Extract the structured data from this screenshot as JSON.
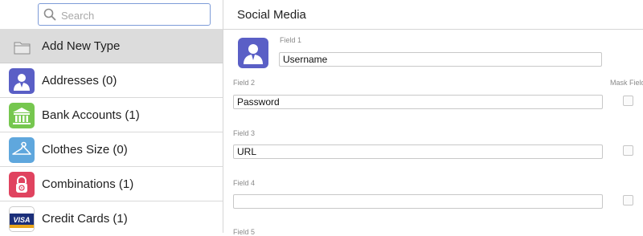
{
  "search": {
    "placeholder": "Search"
  },
  "sidebar": {
    "items": [
      {
        "label": "Add New Type",
        "icon": "folder-icon"
      },
      {
        "label": "Addresses (0)",
        "icon": "person-icon"
      },
      {
        "label": "Bank Accounts (1)",
        "icon": "bank-icon"
      },
      {
        "label": "Clothes Size (0)",
        "icon": "hanger-icon"
      },
      {
        "label": "Combinations (1)",
        "icon": "padlock-icon"
      },
      {
        "label": "Credit Cards (1)",
        "icon": "visa-card-icon",
        "badge": "VISA"
      }
    ]
  },
  "main": {
    "title": "Social Media",
    "type_icon": "person-icon",
    "mask_header": "Mask Field",
    "fields": [
      {
        "label": "Field 1",
        "value": "Username"
      },
      {
        "label": "Field 2",
        "value": "Password"
      },
      {
        "label": "Field 3",
        "value": "URL"
      },
      {
        "label": "Field 4",
        "value": ""
      },
      {
        "label": "Field 5",
        "value": ""
      }
    ]
  },
  "colors": {
    "accent_purple": "#5a5fc6",
    "bank_green": "#76c74f",
    "hanger_blue": "#5fa7dd",
    "lock_red": "#e0435f",
    "active_row": "#dcdcdc"
  }
}
